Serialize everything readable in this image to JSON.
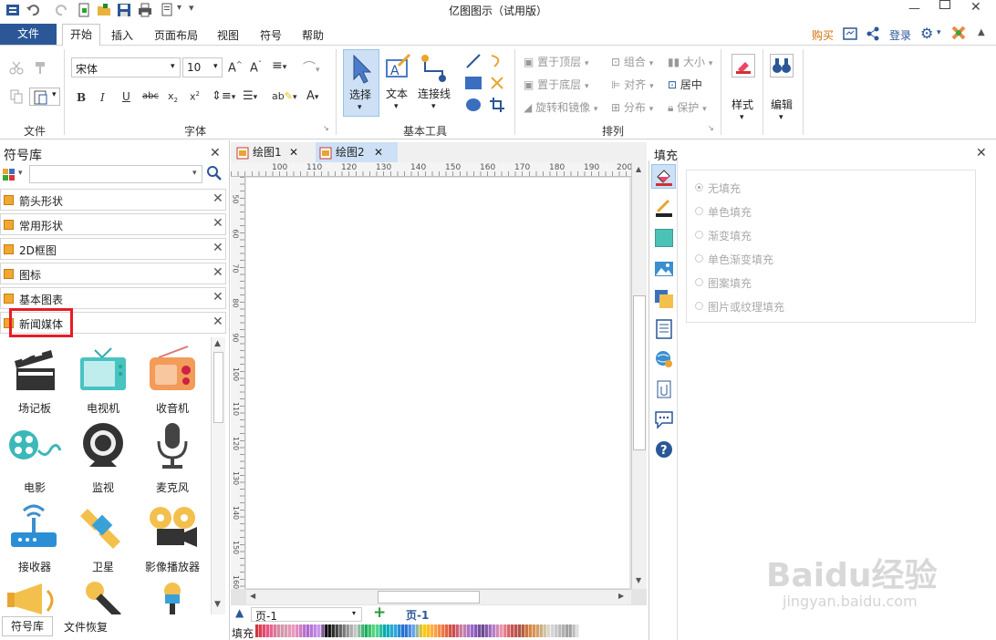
{
  "window": {
    "title": "亿图图示（试用版）"
  },
  "menu": {
    "file": "文件",
    "tabs": [
      "开始",
      "插入",
      "页面布局",
      "视图",
      "符号",
      "帮助"
    ],
    "buy": "购买",
    "login": "登录"
  },
  "ribbon": {
    "font_name": "宋体",
    "font_size": "10",
    "groups": {
      "file": "文件",
      "font": "字体",
      "basic_tools": "基本工具",
      "arrange": "排列"
    },
    "tools": {
      "select": "选择",
      "text": "文本",
      "connector": "连接线"
    },
    "arrange": {
      "bring_front": "置于顶层",
      "send_back": "置于底层",
      "rotate": "旋转和镜像",
      "group": "组合",
      "align": "对齐",
      "distribute": "分布",
      "size": "大小",
      "center": "居中",
      "protect": "保护"
    },
    "style": "样式",
    "edit": "编辑"
  },
  "left_panel": {
    "title": "符号库",
    "categories": [
      "箭头形状",
      "常用形状",
      "2D框图",
      "图标",
      "基本图表",
      "新闻媒体"
    ],
    "symbols": [
      "场记板",
      "电视机",
      "收音机",
      "电影",
      "监视",
      "麦克风",
      "接收器",
      "卫星",
      "影像播放器"
    ],
    "bottom_tabs": [
      "符号库",
      "文件恢复"
    ]
  },
  "canvas": {
    "tabs": [
      "绘图1",
      "绘图2"
    ],
    "ruler_top": [
      "100",
      "110",
      "120",
      "130",
      "140",
      "150",
      "160",
      "170",
      "180",
      "190",
      "200"
    ],
    "ruler_left": [
      "50",
      "60",
      "70",
      "80",
      "90",
      "100",
      "110",
      "120",
      "130",
      "140",
      "150",
      "160"
    ],
    "page_select": "页-1",
    "page_tab": "页-1",
    "fill_label": "填充"
  },
  "right_panel": {
    "title": "填充",
    "options": [
      "无填充",
      "单色填充",
      "渐变填充",
      "单色渐变填充",
      "图案填充",
      "图片或纹理填充"
    ]
  },
  "watermark": {
    "brand": "Baidu经验",
    "url": "jingyan.baidu.com"
  }
}
